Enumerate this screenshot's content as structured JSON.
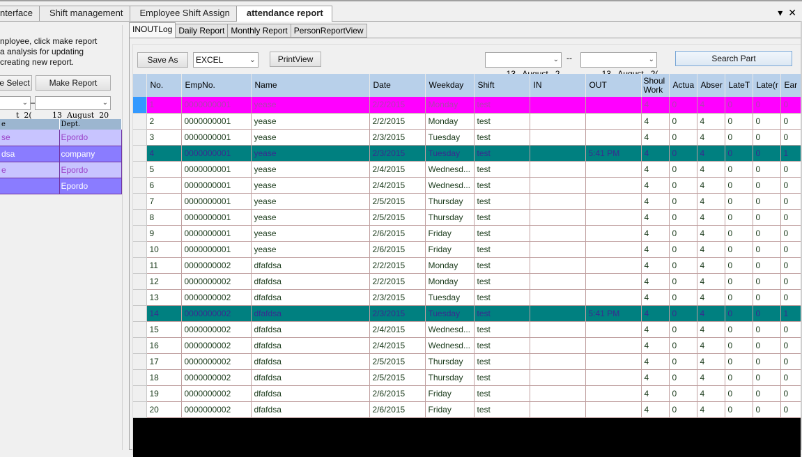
{
  "top_tabs": [
    {
      "label": "nterface",
      "active": false
    },
    {
      "label": "Shift management",
      "active": false
    },
    {
      "label": "Employee Shift Assign",
      "active": false
    },
    {
      "label": "attendance report",
      "active": true
    }
  ],
  "top_controls": {
    "dropdown_icon": "▾",
    "close_icon": "✕"
  },
  "left": {
    "hint": "nployee, click make report\na analysis for updating\ncreating new report.",
    "select_button": "e Select",
    "make_report_button": "Make Report",
    "date_from": "t  2(",
    "date_to": "13  August  20",
    "dept_headers": [
      "e",
      "Dept."
    ],
    "dept_rows": [
      {
        "name": "se",
        "dept": "Epordo",
        "style": "light"
      },
      {
        "name": "dsa",
        "dept": "company",
        "style": "dark"
      },
      {
        "name": "e",
        "dept": "Epordo",
        "style": "light"
      },
      {
        "name": "",
        "dept": "Epordo",
        "style": "dark"
      }
    ]
  },
  "sub_tabs": [
    {
      "label": "INOUTLog",
      "active": true
    },
    {
      "label": "Daily Report",
      "active": false
    },
    {
      "label": "Monthly Report",
      "active": false
    },
    {
      "label": "PersonReportView",
      "active": false
    }
  ],
  "toolbar": {
    "save_as": "Save As",
    "format": "EXCEL",
    "print_view": "PrintView",
    "date_from": "13   August   2",
    "separator": "--",
    "date_to": "13   August   2(",
    "search_part": "Search Part"
  },
  "grid": {
    "headers": [
      "No.",
      "EmpNo.",
      "Name",
      "Date",
      "Weekday",
      "Shift",
      "IN",
      "OUT",
      "Shoul Work",
      "Actua",
      "Abser",
      "LateT",
      "Late(r",
      "Ear"
    ],
    "rows": [
      {
        "style": "magenta",
        "cells": [
          "1",
          "0000000001",
          "yease",
          "2/2/2015",
          "Monday",
          "test",
          "",
          "",
          "4",
          "0",
          "4",
          "0",
          "0",
          "0"
        ]
      },
      {
        "style": "",
        "cells": [
          "2",
          "0000000001",
          "yease",
          "2/2/2015",
          "Monday",
          "test",
          "",
          "",
          "4",
          "0",
          "4",
          "0",
          "0",
          "0"
        ]
      },
      {
        "style": "",
        "cells": [
          "3",
          "0000000001",
          "yease",
          "2/3/2015",
          "Tuesday",
          "test",
          "",
          "",
          "4",
          "0",
          "4",
          "0",
          "0",
          "0"
        ]
      },
      {
        "style": "teal",
        "cells": [
          "4",
          "0000000001",
          "yease",
          "2/3/2015",
          "Tuesday",
          "test",
          "",
          "5:41 PM",
          "4",
          "0",
          "4",
          "0",
          "0",
          "1"
        ]
      },
      {
        "style": "",
        "cells": [
          "5",
          "0000000001",
          "yease",
          "2/4/2015",
          "Wednesd...",
          "test",
          "",
          "",
          "4",
          "0",
          "4",
          "0",
          "0",
          "0"
        ]
      },
      {
        "style": "",
        "cells": [
          "6",
          "0000000001",
          "yease",
          "2/4/2015",
          "Wednesd...",
          "test",
          "",
          "",
          "4",
          "0",
          "4",
          "0",
          "0",
          "0"
        ]
      },
      {
        "style": "",
        "cells": [
          "7",
          "0000000001",
          "yease",
          "2/5/2015",
          "Thursday",
          "test",
          "",
          "",
          "4",
          "0",
          "4",
          "0",
          "0",
          "0"
        ]
      },
      {
        "style": "",
        "cells": [
          "8",
          "0000000001",
          "yease",
          "2/5/2015",
          "Thursday",
          "test",
          "",
          "",
          "4",
          "0",
          "4",
          "0",
          "0",
          "0"
        ]
      },
      {
        "style": "",
        "cells": [
          "9",
          "0000000001",
          "yease",
          "2/6/2015",
          "Friday",
          "test",
          "",
          "",
          "4",
          "0",
          "4",
          "0",
          "0",
          "0"
        ]
      },
      {
        "style": "",
        "cells": [
          "10",
          "0000000001",
          "yease",
          "2/6/2015",
          "Friday",
          "test",
          "",
          "",
          "4",
          "0",
          "4",
          "0",
          "0",
          "0"
        ]
      },
      {
        "style": "",
        "cells": [
          "11",
          "0000000002",
          "dfafdsa",
          "2/2/2015",
          "Monday",
          "test",
          "",
          "",
          "4",
          "0",
          "4",
          "0",
          "0",
          "0"
        ]
      },
      {
        "style": "",
        "cells": [
          "12",
          "0000000002",
          "dfafdsa",
          "2/2/2015",
          "Monday",
          "test",
          "",
          "",
          "4",
          "0",
          "4",
          "0",
          "0",
          "0"
        ]
      },
      {
        "style": "",
        "cells": [
          "13",
          "0000000002",
          "dfafdsa",
          "2/3/2015",
          "Tuesday",
          "test",
          "",
          "",
          "4",
          "0",
          "4",
          "0",
          "0",
          "0"
        ]
      },
      {
        "style": "teal",
        "cells": [
          "14",
          "0000000002",
          "dfafdsa",
          "2/3/2015",
          "Tuesday",
          "test",
          "",
          "5:41 PM",
          "4",
          "0",
          "4",
          "0",
          "0",
          "1"
        ]
      },
      {
        "style": "",
        "cells": [
          "15",
          "0000000002",
          "dfafdsa",
          "2/4/2015",
          "Wednesd...",
          "test",
          "",
          "",
          "4",
          "0",
          "4",
          "0",
          "0",
          "0"
        ]
      },
      {
        "style": "",
        "cells": [
          "16",
          "0000000002",
          "dfafdsa",
          "2/4/2015",
          "Wednesd...",
          "test",
          "",
          "",
          "4",
          "0",
          "4",
          "0",
          "0",
          "0"
        ]
      },
      {
        "style": "",
        "cells": [
          "17",
          "0000000002",
          "dfafdsa",
          "2/5/2015",
          "Thursday",
          "test",
          "",
          "",
          "4",
          "0",
          "4",
          "0",
          "0",
          "0"
        ]
      },
      {
        "style": "",
        "cells": [
          "18",
          "0000000002",
          "dfafdsa",
          "2/5/2015",
          "Thursday",
          "test",
          "",
          "",
          "4",
          "0",
          "4",
          "0",
          "0",
          "0"
        ]
      },
      {
        "style": "",
        "cells": [
          "19",
          "0000000002",
          "dfafdsa",
          "2/6/2015",
          "Friday",
          "test",
          "",
          "",
          "4",
          "0",
          "4",
          "0",
          "0",
          "0"
        ]
      },
      {
        "style": "",
        "cells": [
          "20",
          "0000000002",
          "dfafdsa",
          "2/6/2015",
          "Friday",
          "test",
          "",
          "",
          "4",
          "0",
          "4",
          "0",
          "0",
          "0"
        ]
      }
    ]
  },
  "colors": {
    "highlight_magenta": "#ff00ff",
    "highlight_teal": "#008080",
    "header_blue": "#b8d0ea",
    "dept_light": "#c8c4ff",
    "dept_dark": "#8a7cff"
  }
}
